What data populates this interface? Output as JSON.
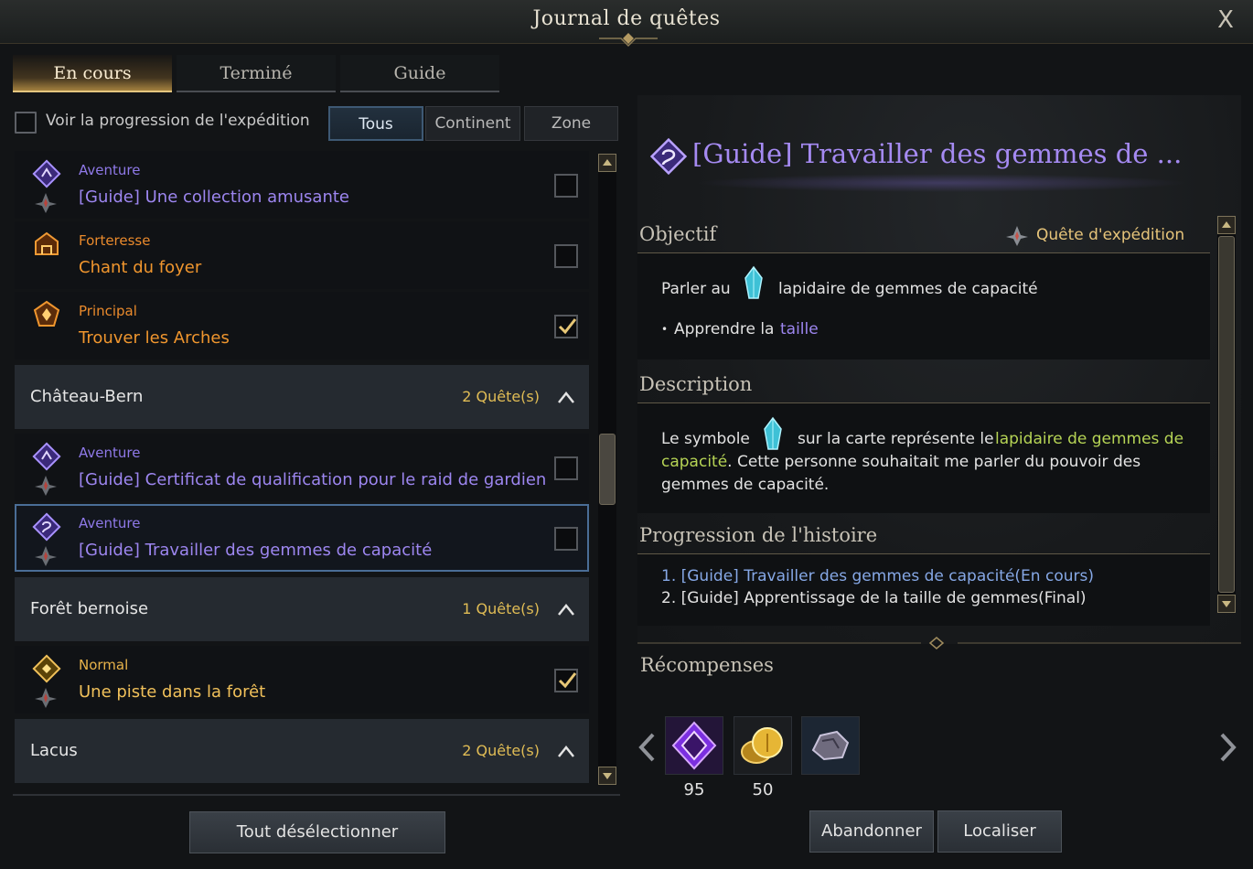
{
  "window": {
    "title": "Journal de quêtes",
    "close_label": "X"
  },
  "tabs": [
    {
      "label": "En cours",
      "active": true
    },
    {
      "label": "Terminé",
      "active": false
    },
    {
      "label": "Guide",
      "active": false
    }
  ],
  "filter": {
    "expedition_label": "Voir la progression de l'expédition",
    "expedition_checked": false,
    "segments": [
      "Tous",
      "Continent",
      "Zone"
    ],
    "selected_segment": "Tous"
  },
  "quests": [
    {
      "type": "Aventure",
      "name": "[Guide] Une collection amusante",
      "checked": false,
      "category": "adventure",
      "icon": "adventure-guide-icon",
      "sub_icon": "expedition-icon"
    },
    {
      "type": "Forteresse",
      "name": "Chant du foyer",
      "checked": false,
      "category": "fortress",
      "icon": "fortress-icon"
    },
    {
      "type": "Principal",
      "name": "Trouver les Arches",
      "checked": true,
      "category": "main",
      "icon": "main-quest-icon"
    }
  ],
  "zones": [
    {
      "name": "Château-Bern",
      "count": "2 Quête(s)",
      "quests": [
        {
          "type": "Aventure",
          "name": "[Guide] Certificat de qualification pour le raid de gardien",
          "checked": false,
          "category": "adventure",
          "icon": "adventure-guide-icon",
          "sub_icon": "expedition-icon"
        },
        {
          "type": "Aventure",
          "name": "[Guide] Travailler des gemmes de capacité",
          "checked": false,
          "category": "adventure",
          "selected": true,
          "icon": "adventure-guide-icon",
          "sub_icon": "expedition-icon"
        }
      ]
    },
    {
      "name": "Forêt bernoise",
      "count": "1 Quête(s)",
      "quests": [
        {
          "type": "Normal",
          "name": "Une piste dans la forêt",
          "checked": true,
          "category": "normal",
          "icon": "normal-quest-icon",
          "sub_icon": "expedition-icon"
        }
      ]
    },
    {
      "name": "Lacus",
      "count": "2 Quête(s)",
      "quests": []
    }
  ],
  "deselect_label": "Tout désélectionner",
  "detail": {
    "title": "[Guide] Travailler des gemmes de ...",
    "objective": {
      "heading": "Objectif",
      "expedition_label": "Quête d'expédition",
      "line_prefix": "Parler au",
      "line_target": "lapidaire de gemmes de capacité",
      "bullet_prefix": "Apprendre la",
      "bullet_highlight": "taille"
    },
    "description": {
      "heading": "Description",
      "part1": "Le symbole",
      "part2": "sur la carte représente le",
      "highlight": "lapidaire de gemmes de capacité",
      "part3": ". Cette personne souhaitait me parler du pouvoir des gemmes de capacité."
    },
    "progression": {
      "heading": "Progression de l'histoire",
      "items": [
        "1. [Guide] Travailler des gemmes de capacité(En cours)",
        "2. [Guide] Apprentissage de la taille de gemmes(Final)"
      ]
    },
    "rewards": {
      "heading": "Récompenses",
      "items": [
        {
          "icon": "purple-gem-chest-icon",
          "count": "95"
        },
        {
          "icon": "gold-coins-icon",
          "count": "50"
        },
        {
          "icon": "ore-stone-icon",
          "count": ""
        }
      ]
    },
    "buttons": {
      "abandon": "Abandonner",
      "locate": "Localiser"
    }
  },
  "colors": {
    "adventure": "#9d86f0",
    "fortress": "#f0962e",
    "main": "#f0962e",
    "normal": "#f0c05a",
    "zone_count": "#e0bc55",
    "highlight_green": "#b6d455"
  }
}
